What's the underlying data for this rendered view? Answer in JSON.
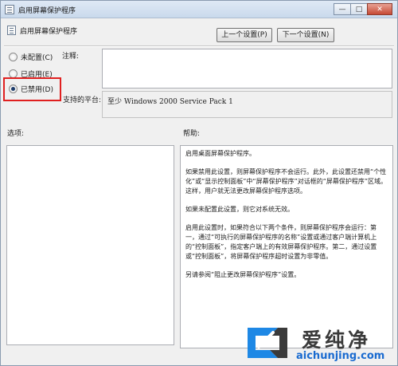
{
  "window": {
    "title": "启用屏幕保护程序",
    "minimize_glyph": "—",
    "maximize_glyph": "□",
    "close_glyph": "✕"
  },
  "header": {
    "title": "启用屏幕保护程序",
    "prev_button": "上一个设置(P)",
    "next_button": "下一个设置(N)"
  },
  "options": {
    "radios": [
      {
        "label": "未配置(C)",
        "checked": false
      },
      {
        "label": "已启用(E)",
        "checked": false
      },
      {
        "label": "已禁用(D)",
        "checked": true
      }
    ],
    "highlight_color": "#e02020"
  },
  "labels": {
    "comment": "注释:",
    "supported_on": "支持的平台:",
    "options": "选项:",
    "help": "帮助:"
  },
  "comment_value": "",
  "supported_platform": "至少 Windows 2000 Service Pack 1",
  "help_text": [
    "启用桌面屏幕保护程序。",
    "如果禁用此设置，则屏幕保护程序不会运行。此外，此设置还禁用“个性化”或“显示控制面板”中“屏幕保护程序”对话框的“屏幕保护程序”区域。这样，用户就无法更改屏幕保护程序选项。",
    "如果未配置此设置，则它对系统无效。",
    "启用此设置时，如果符合以下两个条件，则屏幕保护程序会运行：第一，通过“可执行的屏幕保护程序的名称”设置或通过客户端计算机上的“控制面板”，指定客户端上的有效屏幕保护程序。第二，通过设置或“控制面板”，将屏幕保护程序超时设置为非零值。",
    "另请参阅“阻止更改屏幕保护程序”设置。"
  ],
  "watermark": {
    "title": "爱纯净",
    "url": "aichunjing.com"
  }
}
